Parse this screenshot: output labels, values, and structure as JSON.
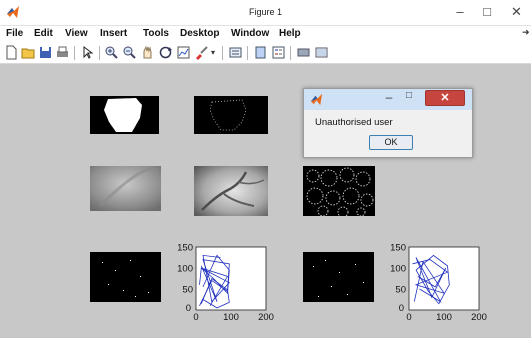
{
  "window": {
    "title": "Figure 1"
  },
  "menu": [
    "File",
    "Edit",
    "View",
    "Insert",
    "Tools",
    "Desktop",
    "Window",
    "Help"
  ],
  "toolbar_icons": [
    "new-figure-icon",
    "open-icon",
    "save-icon",
    "print-icon",
    "pointer-icon",
    "zoom-in-icon",
    "zoom-out-icon",
    "pan-icon",
    "rotate-icon",
    "data-cursor-icon",
    "brush-icon",
    "link-icon",
    "colorbar-icon",
    "legend-icon",
    "hide-plot-tools-icon",
    "show-plot-tools-icon"
  ],
  "dialog": {
    "message": "Unauthorised user",
    "ok_label": "OK"
  },
  "colors": {
    "figure_bg": "#c8c8c8",
    "plot_line": "#1f2fbf",
    "dialog_close": "#c7453f"
  },
  "chart_data": [
    {
      "type": "line",
      "title": "",
      "xlabel": "",
      "ylabel": "",
      "xlim": [
        0,
        200
      ],
      "ylim": [
        0,
        150
      ],
      "xticks": [
        "0",
        "100",
        "200"
      ],
      "yticks": [
        "50",
        "100",
        "150"
      ],
      "y_zero_label": "0",
      "series": [
        {
          "x": [
            15,
            45,
            90,
            95,
            60,
            20,
            15
          ],
          "y": [
            15,
            75,
            48,
            18,
            5,
            25,
            15
          ]
        },
        {
          "x": [
            20,
            60,
            95,
            90,
            50,
            15,
            10
          ],
          "y": [
            55,
            130,
            95,
            40,
            75,
            100,
            60
          ]
        },
        {
          "x": [
            10,
            45,
            90,
            95,
            20,
            60,
            15
          ],
          "y": [
            10,
            70,
            45,
            110,
            120,
            20,
            105
          ]
        },
        {
          "x": [
            40,
            90,
            15,
            95,
            45,
            20,
            70
          ],
          "y": [
            10,
            80,
            100,
            65,
            20,
            130,
            125
          ]
        }
      ]
    },
    {
      "type": "line",
      "title": "",
      "xlabel": "",
      "ylabel": "",
      "xlim": [
        0,
        200
      ],
      "ylim": [
        0,
        150
      ],
      "xticks": [
        "0",
        "100",
        "200"
      ],
      "yticks": [
        "50",
        "100",
        "150"
      ],
      "y_zero_label": "0",
      "series": [
        {
          "x": [
            20,
            70,
            110,
            115,
            85,
            55,
            20
          ],
          "y": [
            95,
            130,
            105,
            60,
            15,
            45,
            95
          ]
        },
        {
          "x": [
            10,
            60,
            110,
            20,
            100,
            40,
            15
          ],
          "y": [
            110,
            120,
            90,
            60,
            40,
            115,
            20
          ]
        },
        {
          "x": [
            25,
            75,
            105,
            65,
            20,
            90,
            30
          ],
          "y": [
            80,
            55,
            100,
            30,
            125,
            20,
            50
          ]
        }
      ]
    }
  ]
}
